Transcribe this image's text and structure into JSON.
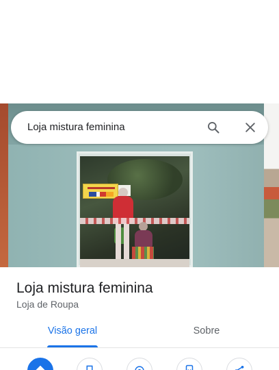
{
  "search": {
    "query": "Loja mistura feminina"
  },
  "place": {
    "name": "Loja mistura feminina",
    "category": "Loja de Roupa"
  },
  "tabs": [
    {
      "label": "Visão geral",
      "active": true
    },
    {
      "label": "Sobre",
      "active": false
    }
  ],
  "actions": [
    {
      "icon": "directions-icon",
      "primary": true
    },
    {
      "icon": "save-icon",
      "primary": false
    },
    {
      "icon": "nearby-icon",
      "primary": false
    },
    {
      "icon": "send-to-phone-icon",
      "primary": false
    },
    {
      "icon": "share-icon",
      "primary": false
    }
  ],
  "colors": {
    "accent": "#1a73e8",
    "text_primary": "#202124",
    "text_secondary": "#5f6368"
  }
}
